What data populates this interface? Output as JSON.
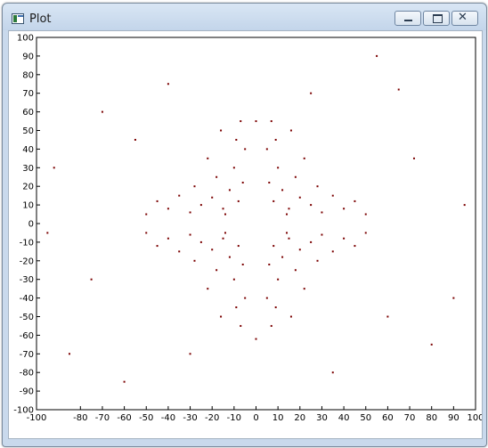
{
  "window": {
    "title": "Plot",
    "icons": {
      "app": "plot-window-icon",
      "minimize": "minimize-icon",
      "maximize": "maximize-icon",
      "close": "close-icon"
    }
  },
  "chart_data": {
    "type": "scatter",
    "title": "",
    "xlabel": "",
    "ylabel": "",
    "xlim": [
      -100,
      100
    ],
    "ylim": [
      -100,
      100
    ],
    "grid": false,
    "marker_color": "#7b0000",
    "x_ticks": [
      -100,
      -80,
      -70,
      -60,
      -50,
      -40,
      -30,
      -20,
      -10,
      0,
      10,
      20,
      30,
      40,
      50,
      60,
      70,
      80,
      90,
      100
    ],
    "y_ticks": [
      100,
      90,
      80,
      70,
      60,
      50,
      40,
      30,
      20,
      10,
      0,
      -10,
      -20,
      -30,
      -40,
      -50,
      -60,
      -70,
      -80,
      -90,
      -100
    ],
    "x_tick_labels": [
      "-100",
      "-80",
      "-70",
      "-60",
      "-50",
      "-40",
      "-30",
      "-20",
      "-10",
      "0",
      "10",
      "20",
      "30",
      "40",
      "50",
      "60",
      "70",
      "80",
      "90",
      "100"
    ],
    "y_tick_labels": [
      "100",
      "90",
      "80",
      "70",
      "60",
      "50",
      "40",
      "30",
      "20",
      "10",
      "0",
      "-10",
      "-20",
      "-30",
      "-40",
      "-50",
      "-60",
      "-70",
      "-80",
      "-90",
      "-100"
    ],
    "series": [
      {
        "points": [
          [
            -8,
            12
          ],
          [
            -12,
            18
          ],
          [
            -15,
            8
          ],
          [
            -20,
            14
          ],
          [
            -6,
            22
          ],
          [
            -25,
            10
          ],
          [
            -10,
            30
          ],
          [
            -18,
            25
          ],
          [
            -30,
            6
          ],
          [
            -5,
            40
          ],
          [
            -35,
            15
          ],
          [
            -14,
            5
          ],
          [
            -9,
            45
          ],
          [
            -22,
            35
          ],
          [
            -40,
            8
          ],
          [
            -28,
            20
          ],
          [
            -7,
            55
          ],
          [
            -45,
            12
          ],
          [
            -16,
            50
          ],
          [
            -50,
            5
          ],
          [
            8,
            12
          ],
          [
            12,
            18
          ],
          [
            15,
            8
          ],
          [
            20,
            14
          ],
          [
            6,
            22
          ],
          [
            25,
            10
          ],
          [
            10,
            30
          ],
          [
            18,
            25
          ],
          [
            30,
            6
          ],
          [
            5,
            40
          ],
          [
            35,
            15
          ],
          [
            14,
            5
          ],
          [
            9,
            45
          ],
          [
            22,
            35
          ],
          [
            40,
            8
          ],
          [
            28,
            20
          ],
          [
            7,
            55
          ],
          [
            45,
            12
          ],
          [
            16,
            50
          ],
          [
            50,
            5
          ],
          [
            -8,
            -12
          ],
          [
            -12,
            -18
          ],
          [
            -15,
            -8
          ],
          [
            -20,
            -14
          ],
          [
            -6,
            -22
          ],
          [
            -25,
            -10
          ],
          [
            -10,
            -30
          ],
          [
            -18,
            -25
          ],
          [
            -30,
            -6
          ],
          [
            -5,
            -40
          ],
          [
            -35,
            -15
          ],
          [
            -14,
            -5
          ],
          [
            -9,
            -45
          ],
          [
            -22,
            -35
          ],
          [
            -40,
            -8
          ],
          [
            -28,
            -20
          ],
          [
            -7,
            -55
          ],
          [
            -45,
            -12
          ],
          [
            -16,
            -50
          ],
          [
            -50,
            -5
          ],
          [
            8,
            -12
          ],
          [
            12,
            -18
          ],
          [
            15,
            -8
          ],
          [
            20,
            -14
          ],
          [
            6,
            -22
          ],
          [
            25,
            -10
          ],
          [
            10,
            -30
          ],
          [
            18,
            -25
          ],
          [
            30,
            -6
          ],
          [
            5,
            -40
          ],
          [
            35,
            -15
          ],
          [
            14,
            -5
          ],
          [
            9,
            -45
          ],
          [
            22,
            -35
          ],
          [
            40,
            -8
          ],
          [
            28,
            -20
          ],
          [
            7,
            -55
          ],
          [
            45,
            -12
          ],
          [
            16,
            -50
          ],
          [
            50,
            -5
          ],
          [
            -70,
            60
          ],
          [
            65,
            72
          ],
          [
            -85,
            -70
          ],
          [
            80,
            -65
          ],
          [
            -60,
            -85
          ],
          [
            55,
            90
          ],
          [
            -92,
            30
          ],
          [
            90,
            -40
          ],
          [
            -40,
            75
          ],
          [
            35,
            -80
          ],
          [
            -75,
            -30
          ],
          [
            72,
            35
          ],
          [
            -55,
            45
          ],
          [
            60,
            -50
          ],
          [
            -30,
            -70
          ],
          [
            25,
            70
          ],
          [
            -95,
            -5
          ],
          [
            95,
            10
          ],
          [
            0,
            55
          ],
          [
            0,
            -62
          ]
        ]
      }
    ]
  }
}
